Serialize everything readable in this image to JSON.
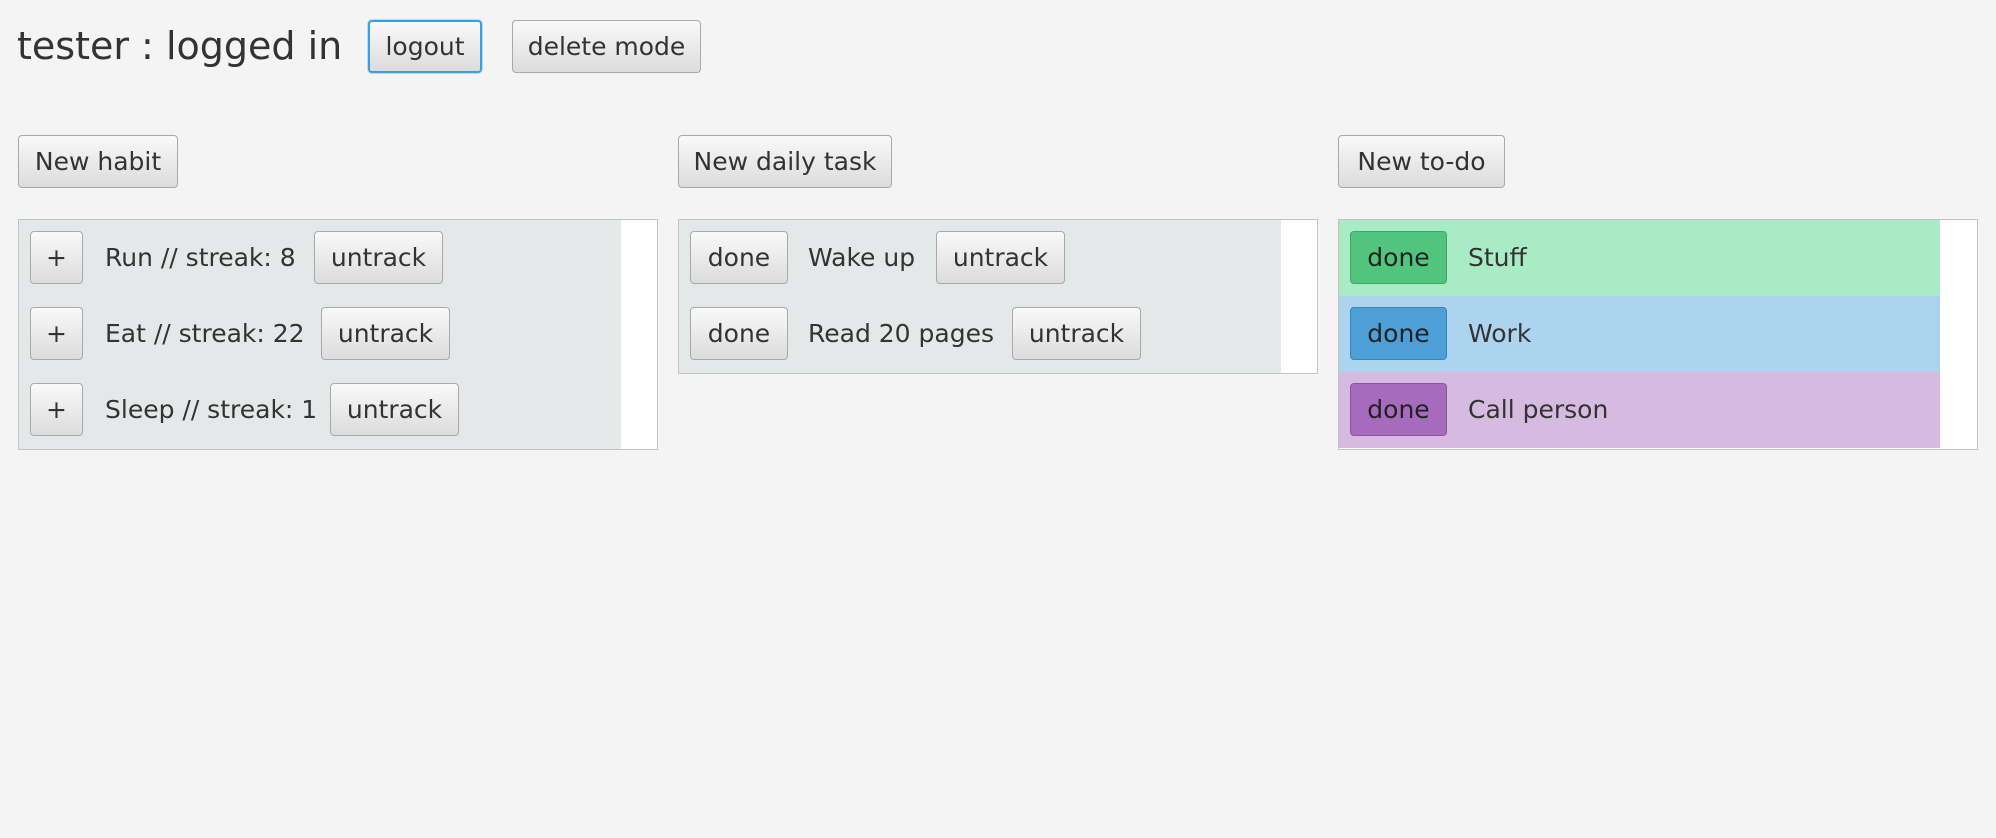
{
  "header": {
    "title": "tester : logged in",
    "logout_label": "logout",
    "delete_mode_label": "delete mode"
  },
  "habits": {
    "new_label": "New habit",
    "items": [
      {
        "increment_label": "+",
        "text": "Run // streak: 8",
        "untrack_label": "untrack"
      },
      {
        "increment_label": "+",
        "text": "Eat // streak: 22",
        "untrack_label": "untrack"
      },
      {
        "increment_label": "+",
        "text": "Sleep // streak: 1",
        "untrack_label": "untrack"
      }
    ]
  },
  "daily_tasks": {
    "new_label": "New daily task",
    "items": [
      {
        "done_label": "done",
        "text": "Wake up",
        "untrack_label": "untrack"
      },
      {
        "done_label": "done",
        "text": "Read 20 pages",
        "untrack_label": "untrack"
      }
    ]
  },
  "todos": {
    "new_label": "New to-do",
    "items": [
      {
        "done_label": "done",
        "text": "Stuff",
        "row_color": "#a8ebc4",
        "button_color": "#52c57d"
      },
      {
        "done_label": "done",
        "text": "Work",
        "row_color": "#acd4ef",
        "button_color": "#4d9fd7"
      },
      {
        "done_label": "done",
        "text": "Call person",
        "row_color": "#d7bae0",
        "button_color": "#a66bbd"
      }
    ]
  },
  "colors": {
    "background": "#f4f4f4",
    "list_row": "#e5e8e8",
    "focus_ring": "#3a9fdd"
  }
}
